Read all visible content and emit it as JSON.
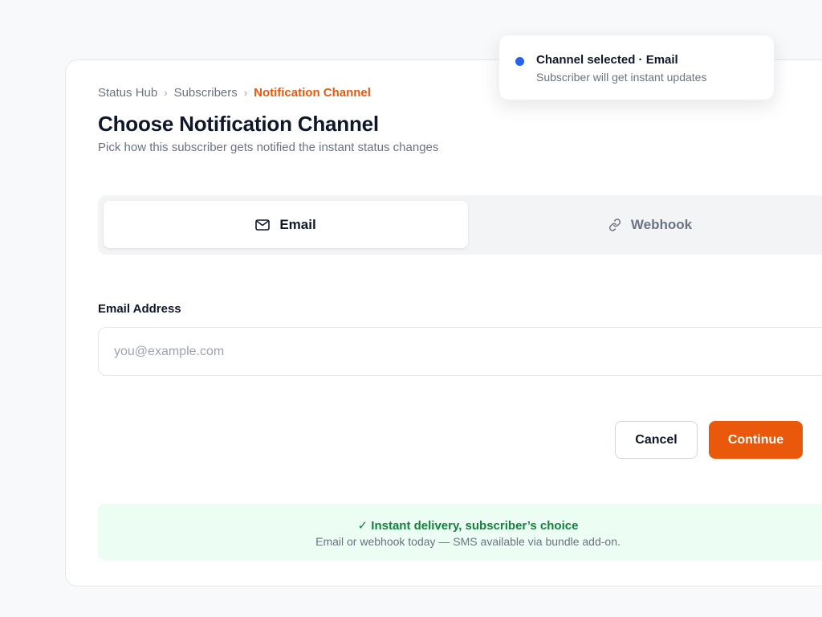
{
  "breadcrumb": {
    "items": [
      "Status Hub",
      "Subscribers"
    ],
    "current": "Notification Channel",
    "separator": "›"
  },
  "page": {
    "title": "Choose Notification Channel",
    "subtitle": "Pick how this subscriber gets notified the instant status changes"
  },
  "channels": {
    "selected": "Email",
    "email": {
      "label": "Email",
      "icon": "mail-icon"
    },
    "webhook": {
      "label": "Webhook",
      "icon": "link-icon"
    }
  },
  "form": {
    "email_label": "Email Address",
    "email_value": "",
    "email_placeholder": "you@example.com"
  },
  "actions": {
    "cancel_label": "Cancel",
    "continue_label": "Continue"
  },
  "banner": {
    "headline": "✓ Instant delivery, subscriber’s choice",
    "note": "Email or webhook today — SMS available via bundle add-on."
  },
  "toast": {
    "title": "Channel selected · Email",
    "body": "Subscriber will get instant updates"
  },
  "colors": {
    "accent": "#ea580c",
    "toast_dot": "#2563eb",
    "success": "#15803d",
    "success_bg": "#ecfdf3"
  }
}
